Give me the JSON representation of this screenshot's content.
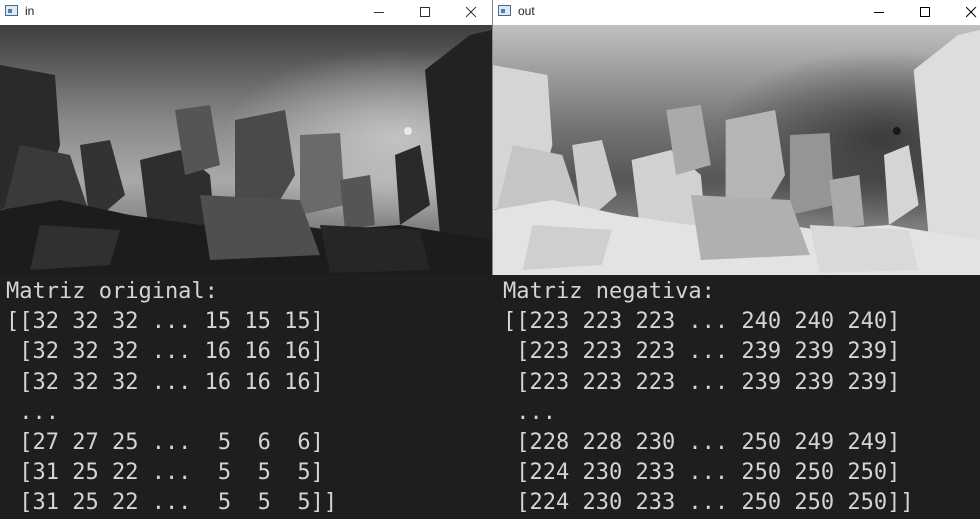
{
  "windows": [
    {
      "title": "in"
    },
    {
      "title": "out"
    }
  ],
  "icons": {
    "app": "app-window-icon",
    "minimize": "minimize-icon",
    "maximize": "maximize-icon",
    "close": "close-icon"
  },
  "console": {
    "original": {
      "heading": "Matriz original:",
      "lines": [
        "[[32 32 32 ... 15 15 15]",
        " [32 32 32 ... 16 16 16]",
        " [32 32 32 ... 16 16 16]",
        " ...",
        " [27 27 25 ...  5  6  6]",
        " [31 25 22 ...  5  5  5]",
        " [31 25 22 ...  5  5  5]]"
      ]
    },
    "negative": {
      "heading": "Matriz negativa:",
      "lines": [
        "[[223 223 223 ... 240 240 240]",
        " [223 223 223 ... 239 239 239]",
        " [223 223 223 ... 239 239 239]",
        " ...",
        " [228 228 230 ... 250 249 249]",
        " [224 230 233 ... 250 250 250]",
        " [224 230 233 ... 250 250 250]]"
      ]
    }
  }
}
